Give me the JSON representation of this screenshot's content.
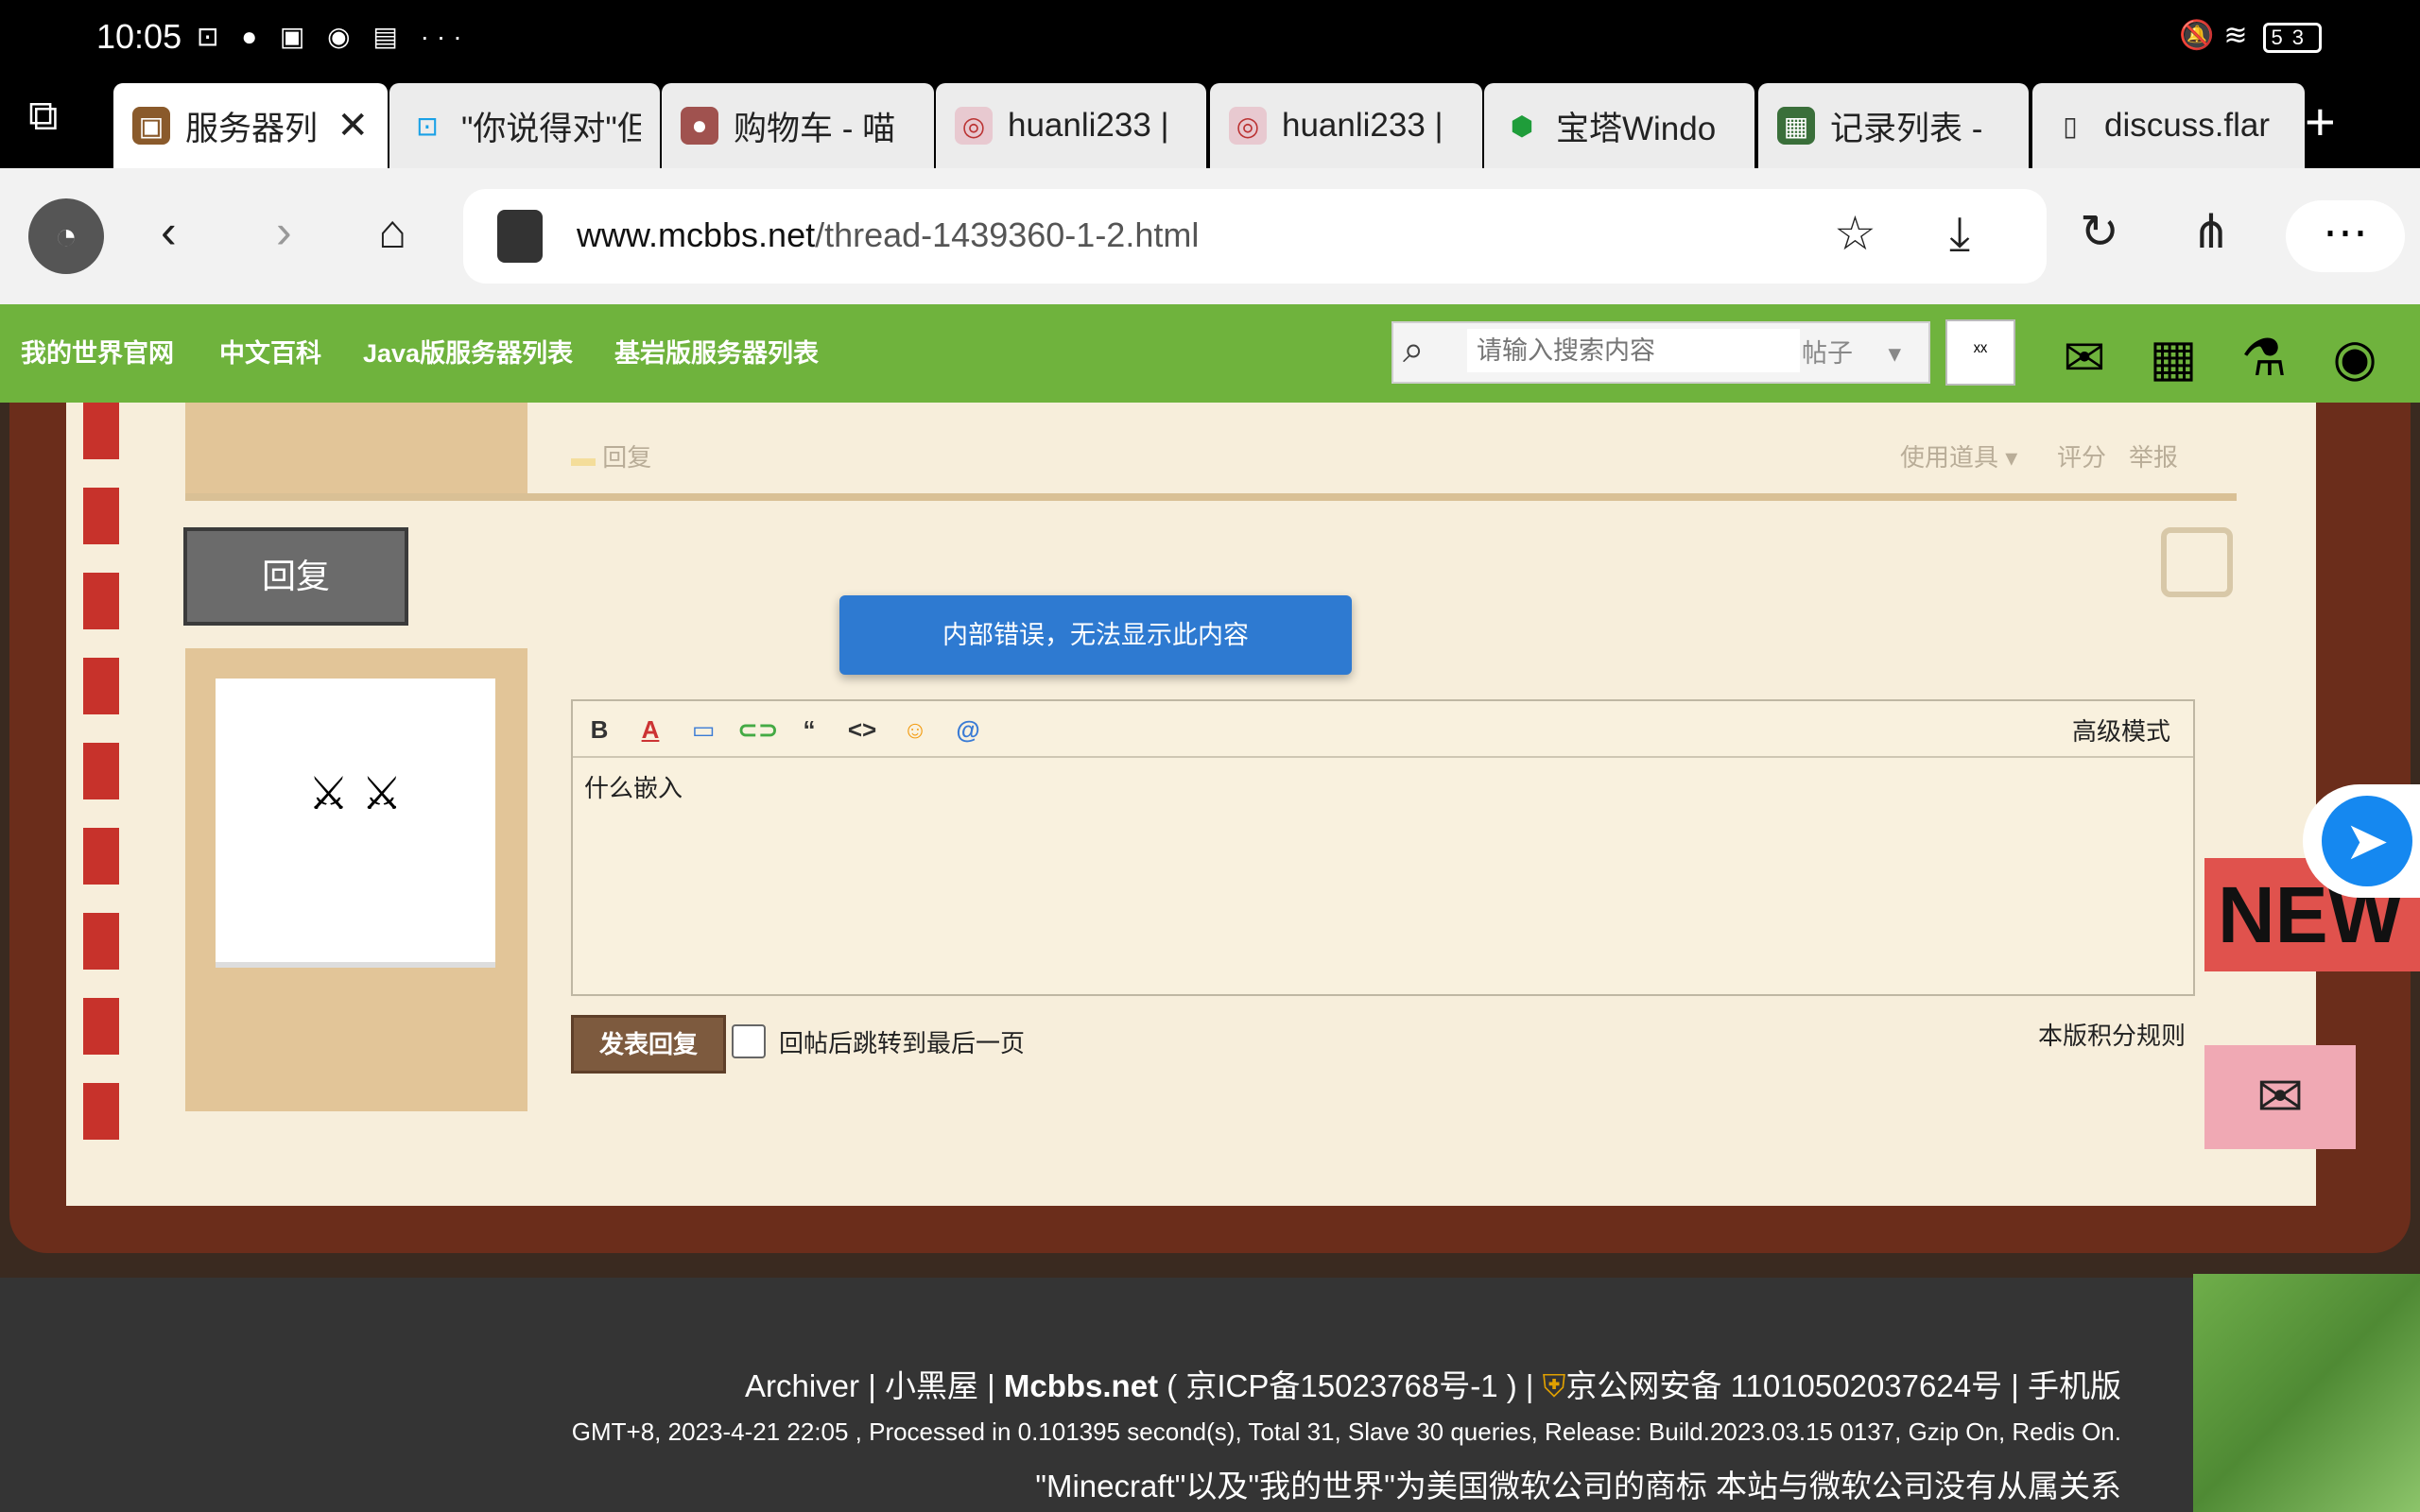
{
  "status_bar": {
    "time": "10:05",
    "notif_icons": "⊡ ● ▣ ◉ ▤ ···",
    "battery": "53"
  },
  "tabs": [
    {
      "title": "服务器列",
      "active": true,
      "close": "✕",
      "icon": "▣"
    },
    {
      "title": "\"你说得对\"但",
      "active": false,
      "icon": "⊡"
    },
    {
      "title": "购物车 - 喵",
      "active": false,
      "icon": "●"
    },
    {
      "title": "huanli233 |",
      "active": false,
      "icon": "◎"
    },
    {
      "title": "huanli233 |",
      "active": false,
      "icon": "◎"
    },
    {
      "title": "宝塔Windo",
      "active": false,
      "icon": "⬢"
    },
    {
      "title": "记录列表 -",
      "active": false,
      "icon": "▦"
    },
    {
      "title": "discuss.flar",
      "active": false,
      "icon": "▯"
    }
  ],
  "toolbar": {
    "url_host": "www.mcbbs.net",
    "url_path": "/thread-1439360-1-2.html"
  },
  "site_nav": {
    "links": [
      "我的世界官网",
      "中文百科",
      "Java版服务器列表",
      "基岩版服务器列表"
    ],
    "search_placeholder": "请输入搜索内容",
    "search_scope": "帖子",
    "search_go": "ˣˣ"
  },
  "post_actions": {
    "reply": "回复",
    "use_tool": "使用道具",
    "rate": "评分",
    "report": "举报"
  },
  "reply_label": "回复",
  "toast": "内部错误，无法显示此内容",
  "editor": {
    "advanced_mode": "高级模式",
    "content": "什么嵌入"
  },
  "submit_label": "发表回复",
  "checkbox_label": "回帖后跳转到最后一页",
  "rules_link": "本版积分规则",
  "badges": {
    "new": "NEW"
  },
  "footer": {
    "archiver": "Archiver",
    "xiaoheiwu": "小黑屋",
    "site": "Mcbbs.net",
    "icp": "( 京ICP备15023768号-1 )",
    "police": "京公网安备 11010502037624号",
    "mobile": "手机版",
    "stats": "GMT+8, 2023-4-21 22:05 , Processed in 0.101395 second(s), Total 31, Slave 30 queries, Release: Build.2023.03.15 0137, Gzip On, Redis On.",
    "trademark": "\"Minecraft\"以及\"我的世界\"为美国微软公司的商标 本站与微软公司没有从属关系"
  }
}
